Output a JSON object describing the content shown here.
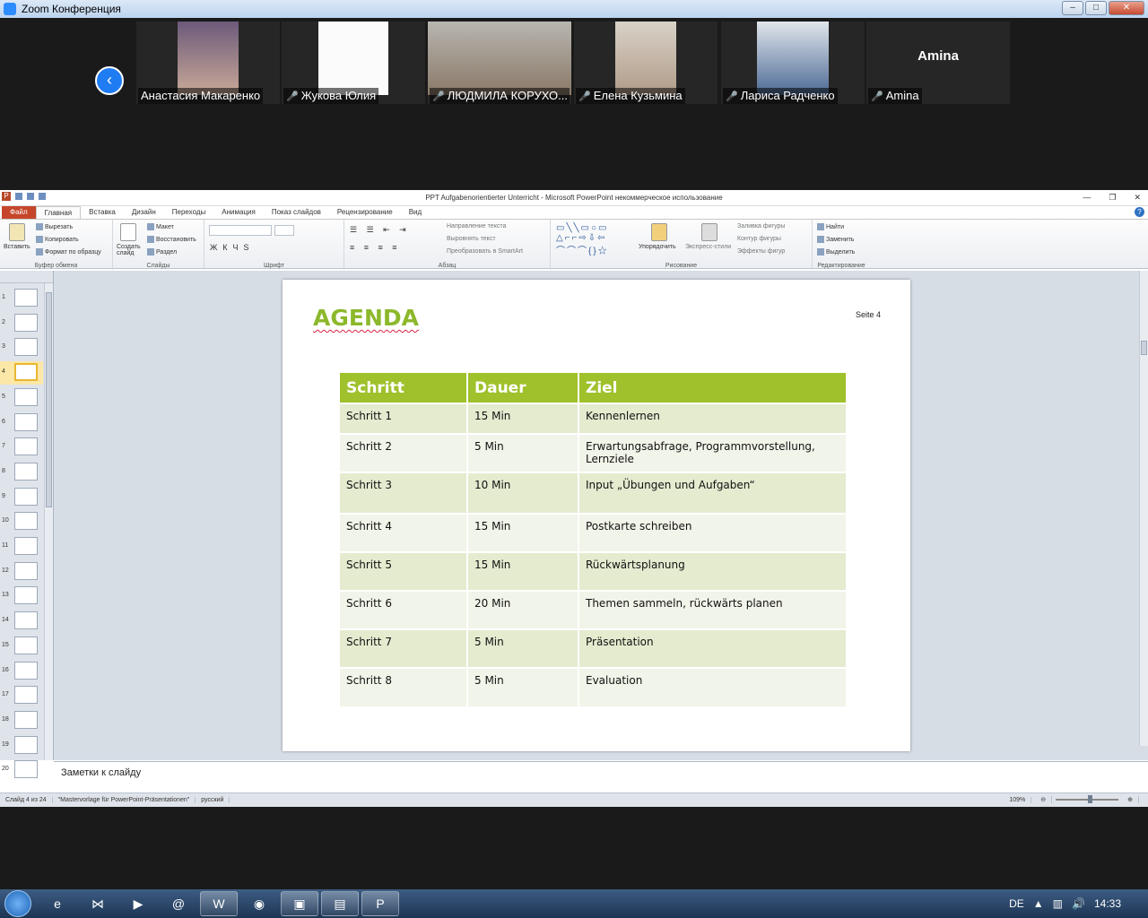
{
  "zoom": {
    "window_title": "Zoom Конференция",
    "participants": [
      {
        "name": "Анастасия Макаренко",
        "muted": false
      },
      {
        "name": "Жукова Юлия",
        "muted": true
      },
      {
        "name": "ЛЮДМИЛА КОРУХО...",
        "muted": true
      },
      {
        "name": "Елена Кузьмина",
        "muted": true
      },
      {
        "name": "Лариса Радченко",
        "muted": true
      },
      {
        "name": "Amina",
        "muted": true,
        "no_video_label": "Amina"
      }
    ]
  },
  "ppt": {
    "window_title": "PPT Aufgabenorientierter Unterricht  -  Microsoft PowerPoint некоммерческое использование",
    "tabs": [
      "Файл",
      "Главная",
      "Вставка",
      "Дизайн",
      "Переходы",
      "Анимация",
      "Показ слайдов",
      "Рецензирование",
      "Вид"
    ],
    "ribbon": {
      "clipboard": {
        "paste": "Вставить",
        "cut": "Вырезать",
        "copy": "Копировать",
        "format_painter": "Формат по образцу",
        "label": "Буфер обмена"
      },
      "slides": {
        "new_slide": "Создать слайд",
        "layout": "Макет",
        "reset": "Восстановить",
        "section": "Раздел",
        "label": "Слайды"
      },
      "font": {
        "label": "Шрифт"
      },
      "paragraph": {
        "text_direction": "Направление текста",
        "align_text": "Выровнять текст",
        "smartart": "Преобразовать в SmartArt",
        "label": "Абзац"
      },
      "drawing": {
        "arrange": "Упорядочить",
        "quick_styles": "Экспресс-стили",
        "fill": "Заливка фигуры",
        "outline": "Контур фигуры",
        "effects": "Эффекты фигур",
        "label": "Рисование"
      },
      "editing": {
        "find": "Найти",
        "replace": "Заменить",
        "select": "Выделить",
        "label": "Редактирование"
      }
    },
    "thumbnails": [
      "1",
      "2",
      "3",
      "4",
      "5",
      "6",
      "7",
      "8",
      "9",
      "10",
      "11",
      "12",
      "13",
      "14",
      "15",
      "16",
      "17",
      "18",
      "19",
      "20"
    ],
    "selected_slide": 4,
    "slide": {
      "title": "AGENDA",
      "page": "Seite 4",
      "headers": [
        "Schritt",
        "Dauer",
        "Ziel"
      ],
      "rows": [
        [
          "Schritt 1",
          "15 Min",
          "Kennenlernen"
        ],
        [
          "Schritt 2",
          "5 Min",
          "Erwartungsabfrage, Programmvorstellung, Lernziele"
        ],
        [
          "Schritt 3",
          "10 Min",
          "Input „Übungen und Aufgaben“"
        ],
        [
          "Schritt 4",
          "15 Min",
          "Postkarte schreiben"
        ],
        [
          "Schritt 5",
          "15 Min",
          "Rückwärtsplanung"
        ],
        [
          "Schritt 6",
          "20 Min",
          "Themen sammeln, rückwärts planen"
        ],
        [
          "Schritt 7",
          "5 Min",
          "Präsentation"
        ],
        [
          "Schritt 8",
          "5 Min",
          "Evaluation"
        ]
      ]
    },
    "notes_placeholder": "Заметки к слайду",
    "status": {
      "slide_counter": "Слайд 4 из 24",
      "theme": "\"Mastervorlage für PowerPoint-Präsentationen\"",
      "language": "русский",
      "zoom": "109%"
    }
  },
  "taskbar": {
    "language": "DE",
    "clock": "14:33"
  }
}
